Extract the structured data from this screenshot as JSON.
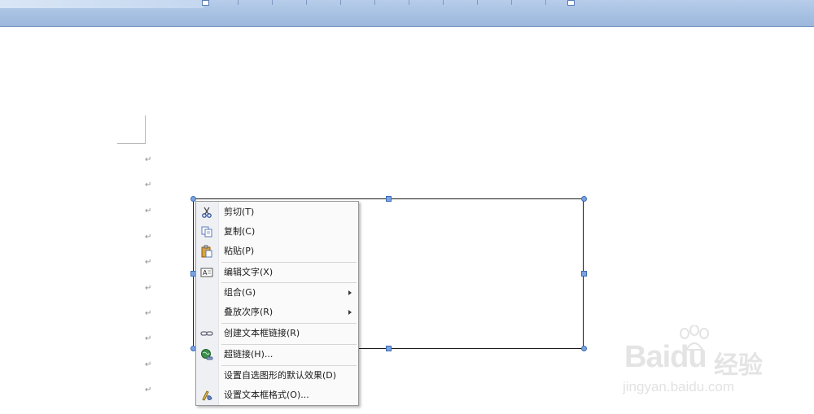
{
  "paragraph_mark": "↵",
  "context_menu": {
    "items": [
      {
        "label": "剪切(T)",
        "icon": "scissors-icon"
      },
      {
        "label": "复制(C)",
        "icon": "copy-icon"
      },
      {
        "label": "粘贴(P)",
        "icon": "paste-icon"
      },
      {
        "label": "编辑文字(X)",
        "icon": "edit-text-icon"
      },
      {
        "label": "组合(G)",
        "submenu": true
      },
      {
        "label": "叠放次序(R)",
        "submenu": true
      },
      {
        "label": "创建文本框链接(R)",
        "icon": "link-chain-icon"
      },
      {
        "label": "超链接(H)...",
        "icon": "hyperlink-globe-icon"
      },
      {
        "label": "设置自选图形的默认效果(D)"
      },
      {
        "label": "设置文本框格式(O)...",
        "icon": "format-textbox-icon"
      }
    ]
  },
  "watermark": {
    "brand": "Baidu",
    "cn": "经验",
    "url": "jingyan.baidu.com"
  },
  "colors": {
    "ruler": "#a6c0e2",
    "handle": "#7aa3e0",
    "menu_bg": "#fafafa",
    "gutter": "#eef0f3"
  }
}
